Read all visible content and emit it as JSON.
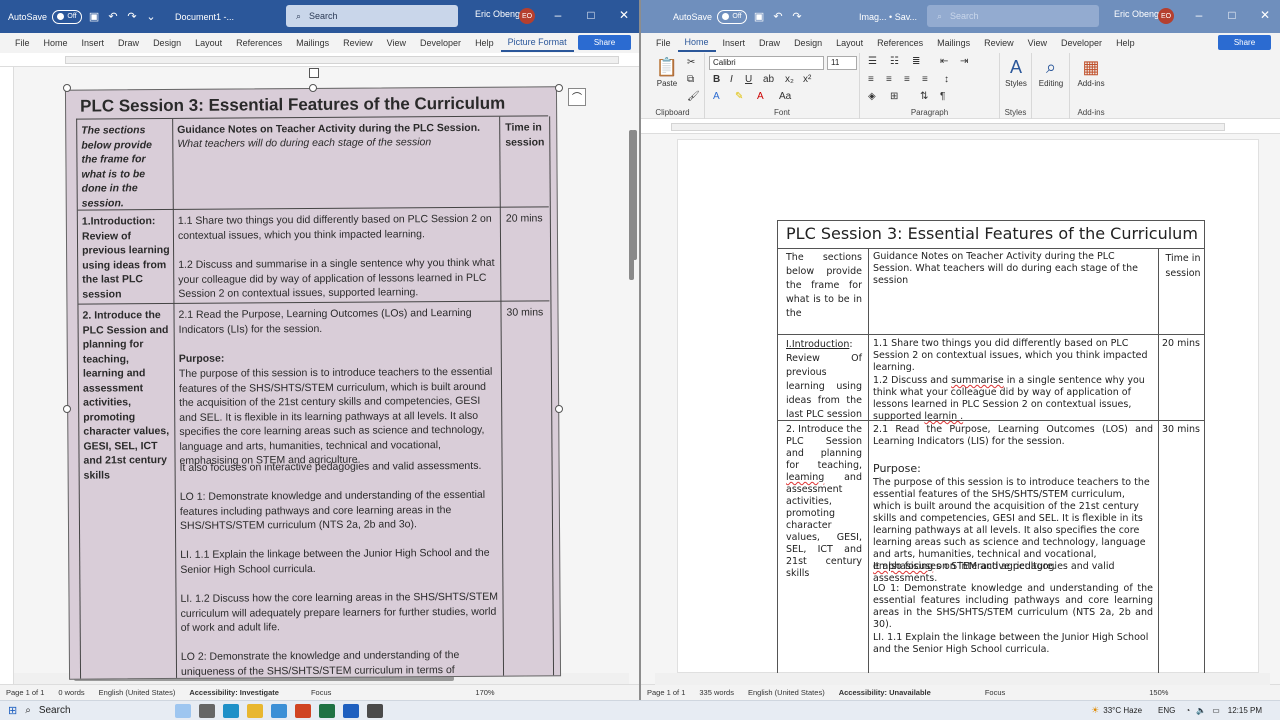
{
  "left": {
    "autosave": "AutoSave",
    "toggle": "Off",
    "docname": "Document1 -...",
    "search": "Search",
    "user": "Eric Obeng",
    "initials": "EO",
    "menu": [
      "File",
      "Home",
      "Insert",
      "Draw",
      "Design",
      "Layout",
      "References",
      "Mailings",
      "Review",
      "View",
      "Developer",
      "Help",
      "Picture Format"
    ],
    "share": "Share",
    "status": {
      "page": "Page 1 of 1",
      "words": "0 words",
      "lang": "English (United States)",
      "access": "Accessibility: Investigate",
      "focus": "Focus",
      "zoom": "170%"
    },
    "pic": {
      "title": "PLC Session 3: Essential Features of the Curriculum",
      "h1": "The sections below provide the frame for what is to be done in the session.",
      "h2a": "Guidance Notes on Teacher Activity during the PLC Session.",
      "h2b": "What teachers will do during each stage of the session",
      "h3": "Time in session",
      "r1a": "1.Introduction: Review of previous learning using ideas from the last PLC session",
      "r1b1": "1.1 Share two things you did differently based on PLC Session 2 on contextual issues, which you think impacted learning.",
      "r1b2": "1.2 Discuss and summarise in a single sentence why you think what your colleague did by way of application of lessons learned in PLC Session 2 on contextual issues, supported learning.",
      "r1c": "20 mins",
      "r2a": "2. Introduce the PLC Session and planning for teaching, learning and assessment activities, promoting character values, GESI, SEL, ICT and 21st century skills",
      "r2b1": "2.1 Read the Purpose, Learning Outcomes (LOs) and Learning Indicators (LIs) for the session.",
      "r2b2": "Purpose:",
      "r2b3": "The purpose of this session is to introduce teachers to the essential features of the SHS/SHTS/STEM curriculum, which is built around the acquisition of the 21st century skills and competencies, GESI and SEL. It is flexible in its learning pathways at all levels. It also specifies the core learning areas such as science and technology, language and arts, humanities, technical and vocational, emphasising on STEM and agriculture.",
      "r2b4": "It also focuses on interactive pedagogies and valid assessments.",
      "r2b5": "LO 1: Demonstrate knowledge and understanding of the essential features including pathways and core learning areas in the SHS/SHTS/STEM curriculum (NTS 2a, 2b and 3o).",
      "r2b6": "LI. 1.1 Explain the linkage between the Junior High School and the Senior High School curricula.",
      "r2b7": "LI. 1.2 Discuss how the core learning areas in the SHS/SHTS/STEM curriculum will adequately prepare learners for further studies, world of work and adult life.",
      "r2b8": "LO 2: Demonstrate the knowledge and understanding of the uniqueness of the SHS/SHTS/STEM curriculum in terms of",
      "r2c": "30 mins"
    }
  },
  "right": {
    "autosave": "AutoSave",
    "toggle": "Off",
    "docname": "Imag... • Sav...",
    "search": "Search",
    "user": "Eric Obeng",
    "initials": "EO",
    "menu": [
      "File",
      "Home",
      "Insert",
      "Draw",
      "Design",
      "Layout",
      "References",
      "Mailings",
      "Review",
      "View",
      "Developer",
      "Help"
    ],
    "share": "Share",
    "ribbon": {
      "paste": "Paste",
      "clipboard": "Clipboard",
      "font_name": "Calibri",
      "font_size": "11",
      "font": "Font",
      "paragraph": "Paragraph",
      "styles": "Styles",
      "styles_grp": "Styles",
      "editing": "Editing",
      "addins": "Add-ins",
      "addins_grp": "Add-ins"
    },
    "status": {
      "page": "Page 1 of 1",
      "words": "335 words",
      "lang": "English (United States)",
      "access": "Accessibility: Unavailable",
      "focus": "Focus",
      "zoom": "150%"
    },
    "doc": {
      "title": "PLC Session 3: Essential Features of the Curriculum",
      "h1": "The sections below provide the frame for what is to be in the",
      "h2": "Guidance Notes on Teacher Activity during the PLC Session. What teachers will do during each stage of the session",
      "h3": "Time in session",
      "r1a_u": "I.Introduction",
      "r1a": ": Review Of previous learning using ideas from the last PLC session",
      "r1b1": "1.1 Share two things you did differently based on PLC Session 2 on contextual issues, which you think impacted learning.",
      "r1b2_pre": "1.2 Discuss and ",
      "r1b2_u": "summarise",
      "r1b2_post": " in a single sentence why you think what your colleague did by way of application of lessons learned in PLC Session 2 on contextual issues, supported ",
      "r1b2_end": "learnin .",
      "r1c": "20 mins",
      "r2a_pre": "2. Introduce the PLC Session and planning for teaching, ",
      "r2a_u": "leaming",
      "r2a_post": " and assessment activities, promoting character values, GESI, SEL, ICT and 21st century skills",
      "r2b1": "2.1 Read the Purpose, Learning Outcomes (LOS) and Learning Indicators (LIS) for the session.",
      "r2b2": "Purpose:",
      "r2b3_pre": "The purpose of this session is to introduce teachers to the essential features of the SHS/SHTS/STEM curriculum, which is built around the acquisition of the 21st century skills and competencies, GESI and SEL. It is flexible in its learning pathways at all levels. It also specifies the core learning areas such as science and technology, language and arts, humanities, technical and vocational, ",
      "r2b3_u": "emphasising",
      "r2b3_post": " on STEM and agriculture.",
      "r2b4": "It also focuses on interactive pedagogies and valid assessments.",
      "r2b5": "LO 1: Demonstrate knowledge and understanding of the essential features including pathways and core learning areas in the SHS/SHTS/STEM curriculum (NTS 2a, 2b and 30).",
      "r2b6": "LI. 1.1 Explain the linkage between the Junior High School and the Senior High School curricula.",
      "r2c": "30 mins"
    }
  },
  "taskbar": {
    "search": "Search",
    "weather": "33°C Haze",
    "lang": "ENG",
    "time": "12:15 PM"
  }
}
